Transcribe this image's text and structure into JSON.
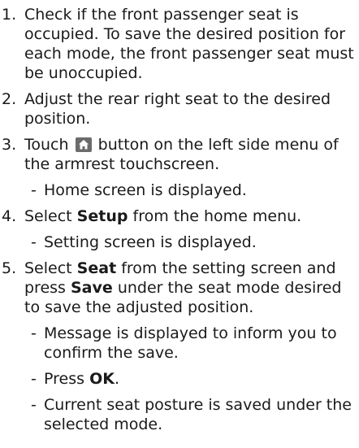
{
  "steps": [
    {
      "num": "1.",
      "text": "Check if the front passenger seat is occupied. To save the desired position for each mode, the front passenger seat must be unoccupied."
    },
    {
      "num": "2.",
      "text": "Adjust the rear right seat to the desired position."
    },
    {
      "num": "3.",
      "pre": "Touch",
      "icon": "home-icon",
      "post": "button on the left side menu of the armrest touchscreen.",
      "subs": [
        "Home screen is displayed."
      ]
    },
    {
      "num": "4.",
      "pre": "Select",
      "bold": "Setup",
      "post": "from the home menu.",
      "subs": [
        "Setting screen is displayed."
      ]
    },
    {
      "num": "5.",
      "pre": "Select",
      "bold": "Seat",
      "mid": "from the setting screen and press",
      "bold2": "Save",
      "post": "under the seat mode desired to save the adjusted position.",
      "subs": [
        "Message is displayed to inform you to confirm the save."
      ],
      "sub_press_pre": "Press",
      "sub_press_bold": "OK",
      "sub_press_post": ".",
      "sub_last": "Current seat posture is saved under the selected mode."
    }
  ],
  "dash": "-"
}
